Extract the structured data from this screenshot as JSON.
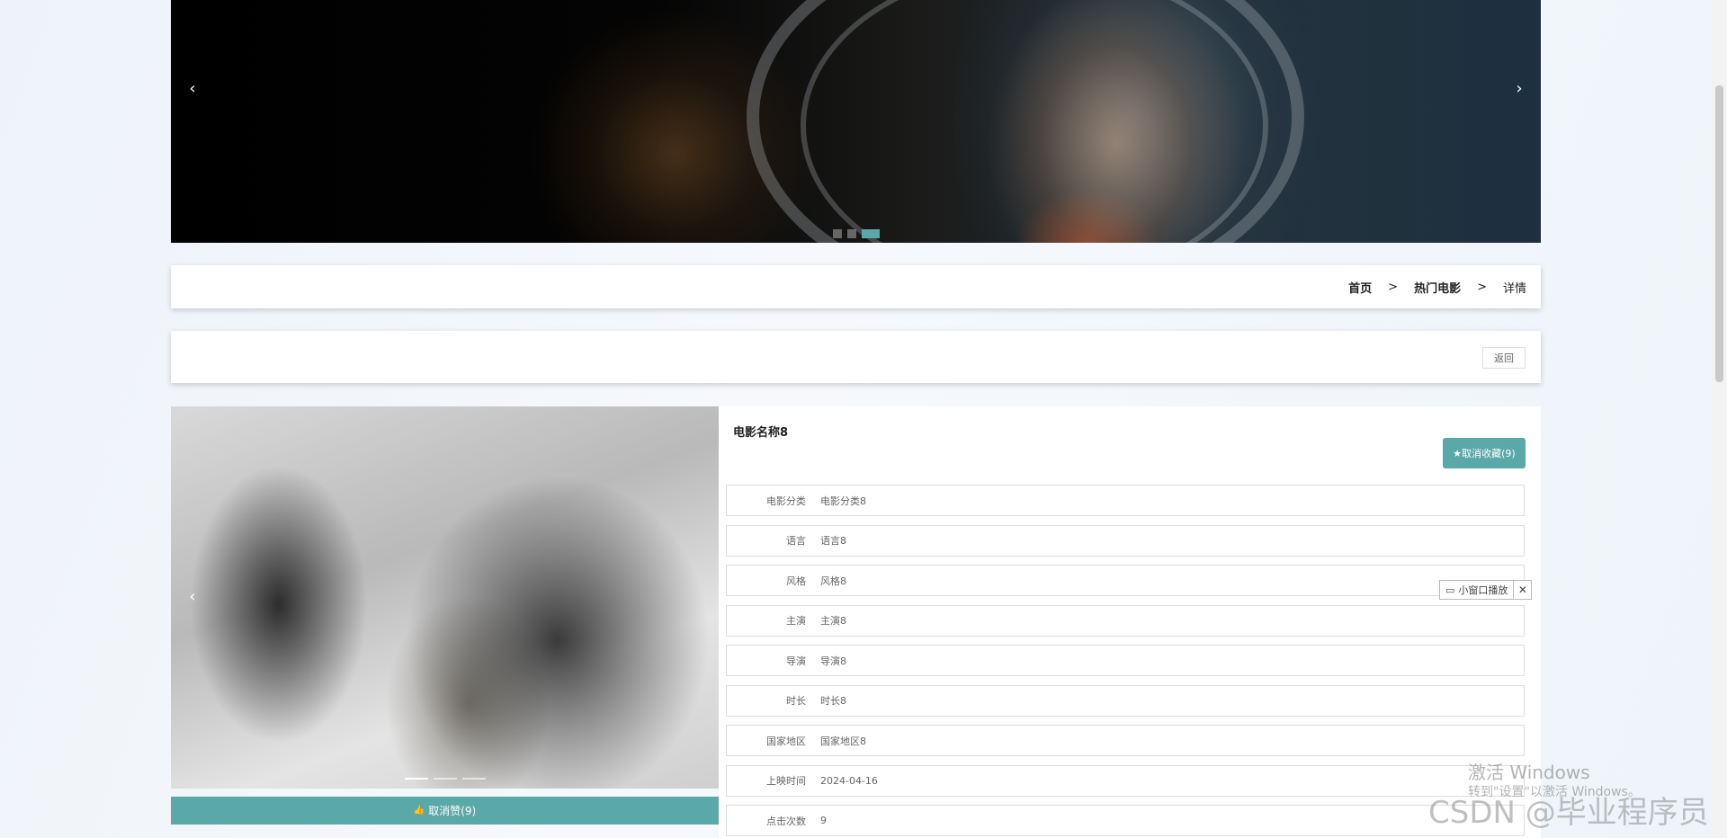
{
  "banner": {
    "prev_icon": "chevron-left-icon",
    "next_icon": "chevron-right-icon",
    "prev_glyph": "‹",
    "next_glyph": "›",
    "slides": 3,
    "active_slide": 3
  },
  "breadcrumb": {
    "home": "首页",
    "section": "热门电影",
    "current": "详情",
    "separator": ">"
  },
  "back_button": "返回",
  "poster": {
    "prev_glyph": "‹",
    "slides": 3,
    "active_slide": 1
  },
  "like_button": {
    "icon": "thumbs-up-icon",
    "icon_glyph": "👍",
    "label": "取消赞(9)"
  },
  "movie": {
    "title": "电影名称8",
    "favorite_button": {
      "icon": "star-icon",
      "icon_glyph": "★",
      "label": "取消收藏(9)"
    },
    "fields": [
      {
        "label": "电影分类",
        "value": "电影分类8"
      },
      {
        "label": "语言",
        "value": "语言8"
      },
      {
        "label": "风格",
        "value": "风格8"
      },
      {
        "label": "主演",
        "value": "主演8"
      },
      {
        "label": "导演",
        "value": "导演8"
      },
      {
        "label": "时长",
        "value": "时长8"
      },
      {
        "label": "国家地区",
        "value": "国家地区8"
      },
      {
        "label": "上映时间",
        "value": "2024-04-16"
      },
      {
        "label": "点击次数",
        "value": "9"
      }
    ]
  },
  "mini_player": {
    "icon": "tv-icon",
    "icon_glyph": "▭",
    "label": "小窗口播放",
    "close_glyph": "✕"
  },
  "watermarks": {
    "activate_title": "激活 Windows",
    "activate_sub": "转到\"设置\"以激活 Windows。",
    "csdn": "CSDN @毕业程序员"
  },
  "colors": {
    "accent": "#5ba8a8"
  }
}
